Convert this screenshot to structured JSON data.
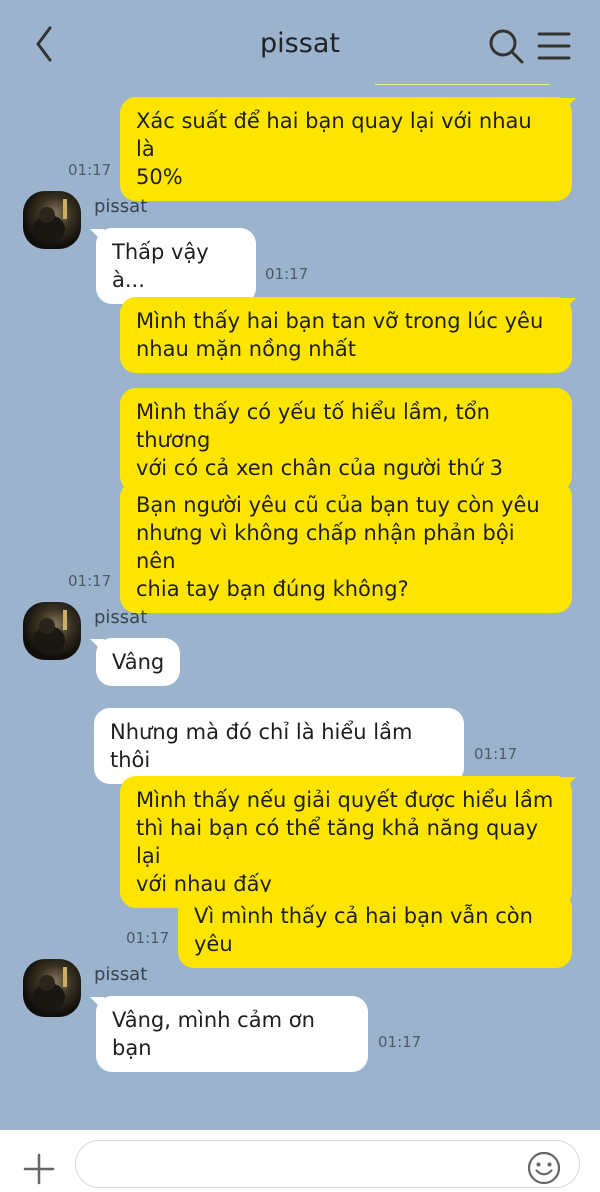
{
  "header": {
    "title": "pissat"
  },
  "messages": [
    {
      "from": "me",
      "lines": [
        "Xác suất để hai bạn quay lại với nhau là",
        "50%"
      ],
      "time": "01:17"
    },
    {
      "from": "them",
      "sender": "pissat",
      "lines": [
        "Thấp vậy à..."
      ],
      "time": "01:17"
    },
    {
      "from": "me",
      "lines": [
        "Mình thấy hai bạn tan vỡ trong lúc yêu",
        "nhau mặn nồng nhất"
      ]
    },
    {
      "from": "me",
      "lines": [
        "Mình thấy có yếu tố hiểu lầm, tổn thương",
        "với có cả xen chân của người thứ 3"
      ]
    },
    {
      "from": "me",
      "lines": [
        "Bạn người yêu cũ của bạn tuy còn yêu",
        "nhưng vì không chấp nhận phản bội nên",
        "chia tay bạn đúng không?"
      ],
      "time": "01:17"
    },
    {
      "from": "them",
      "sender": "pissat",
      "lines": [
        "Vâng"
      ]
    },
    {
      "from": "them",
      "lines": [
        "Nhưng mà đó chỉ là hiểu lầm thôi"
      ],
      "time": "01:17"
    },
    {
      "from": "me",
      "lines": [
        "Mình thấy nếu giải quyết được hiểu lầm",
        "thì hai bạn có thể tăng khả năng quay lại",
        "với nhau đấy"
      ]
    },
    {
      "from": "me",
      "lines": [
        "Vì mình thấy cả hai bạn vẫn còn yêu"
      ],
      "time": "01:17"
    },
    {
      "from": "them",
      "sender": "pissat",
      "lines": [
        "Vâng, mình cảm ơn bạn"
      ],
      "time": "01:17"
    }
  ],
  "composer": {
    "placeholder": ""
  },
  "icons": {
    "back": "chevron-left-icon",
    "search": "search-icon",
    "menu": "menu-icon",
    "add": "plus-icon",
    "emoji": "emoji-icon"
  },
  "colors": {
    "background": "#9bb3cd",
    "my_bubble": "#fee500",
    "their_bubble": "#ffffff"
  }
}
